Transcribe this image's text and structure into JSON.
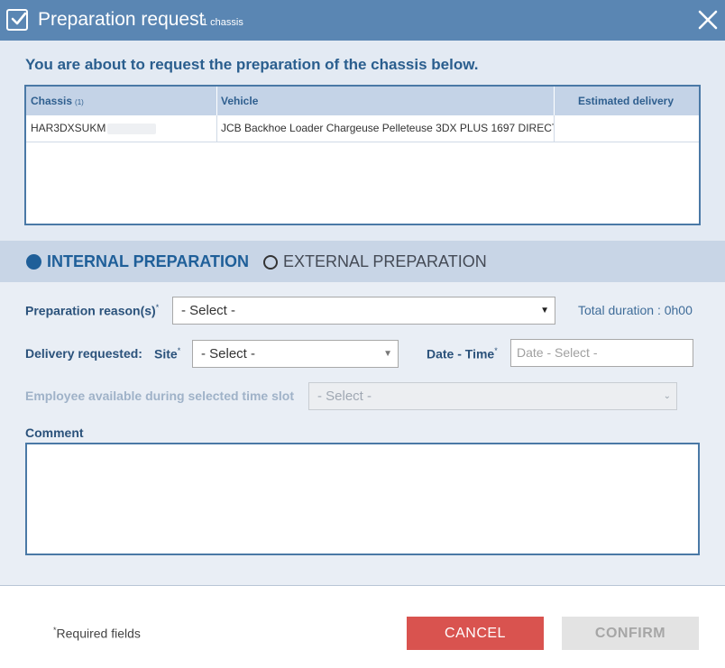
{
  "dialog": {
    "title": "Preparation request",
    "title_count": "1 chassis",
    "intro": "You are about to request the preparation of the chassis below."
  },
  "table": {
    "headers": {
      "chassis": "Chassis",
      "chassis_count": "(1)",
      "vehicle": "Vehicle",
      "estimated_delivery": "Estimated delivery"
    },
    "rows": [
      {
        "chassis": "HAR3DXSUKM",
        "vehicle": "JCB Backhoe Loader Chargeuse Pelleteuse 3DX PLUS 1697 DIRECT",
        "estimated_delivery": ""
      }
    ]
  },
  "preparation_type": {
    "internal": "INTERNAL PREPARATION",
    "external": "EXTERNAL PREPARATION",
    "selected": "internal"
  },
  "form": {
    "reasons_label": "Preparation reason(s)",
    "reasons_value": "- Select -",
    "total_duration": "Total duration : 0h00",
    "delivery_label": "Delivery requested:",
    "site_label": "Site",
    "site_value": "- Select -",
    "date_label": "Date - Time",
    "date_placeholder": "Date - Select -",
    "employee_label": "Employee available during selected time slot",
    "employee_value": "- Select -",
    "comment_label": "Comment",
    "comment_value": "",
    "required_mark": "*"
  },
  "footer": {
    "required_note": "Required fields",
    "cancel": "CANCEL",
    "confirm": "CONFIRM"
  },
  "colors": {
    "title_bar": "#5a86b3",
    "accent": "#1f5f99",
    "cancel": "#d9534f",
    "confirm_disabled": "#e3e3e3"
  },
  "icons": {
    "title": "checkbox-checked-icon",
    "close": "close-icon",
    "dropdown": "caret-down-icon"
  }
}
